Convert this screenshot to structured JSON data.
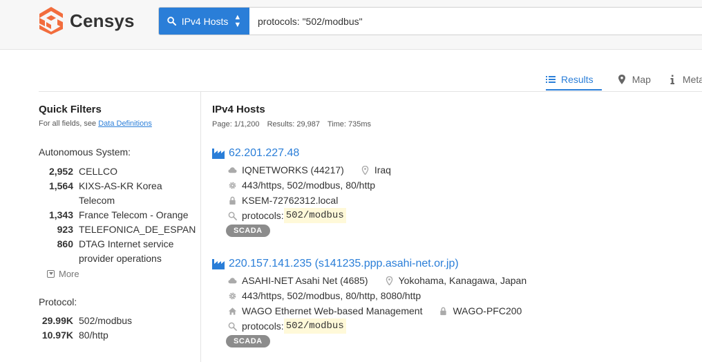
{
  "app": {
    "logo_text": "Censys"
  },
  "search": {
    "type_label": "IPv4 Hosts",
    "query": "protocols: \"502/modbus\""
  },
  "tabs": [
    {
      "label": "Results",
      "icon": "list-icon",
      "active": true
    },
    {
      "label": "Map",
      "icon": "map-marker-icon",
      "active": false
    },
    {
      "label": "Metada",
      "icon": "info-icon",
      "active": false
    }
  ],
  "sidebar": {
    "title": "Quick Filters",
    "subtitle_prefix": "For all fields, see ",
    "subtitle_link": "Data Definitions",
    "facets": [
      {
        "title": "Autonomous System:",
        "items": [
          {
            "count": "2,952",
            "label": "CELLCO"
          },
          {
            "count": "1,564",
            "label": "KIXS-AS-KR Korea Telecom"
          },
          {
            "count": "1,343",
            "label": "France Telecom - Orange"
          },
          {
            "count": "923",
            "label": "TELEFONICA_DE_ESPAN"
          },
          {
            "count": "860",
            "label": "DTAG Internet service provider operations"
          }
        ],
        "more_label": "More"
      },
      {
        "title": "Protocol:",
        "items": [
          {
            "count": "29.99K",
            "label": "502/modbus"
          },
          {
            "count": "10.97K",
            "label": "80/http"
          }
        ]
      }
    ]
  },
  "main": {
    "title": "IPv4 Hosts",
    "page": "Page: 1/1,200",
    "results_count": "Results: 29,987",
    "time": "Time: 735ms",
    "results": [
      {
        "title": "62.201.227.48",
        "network": "IQNETWORKS (44217)",
        "location": "Iraq",
        "services": "443/https, 502/modbus, 80/http",
        "cert": "KSEM-72762312.local",
        "match_prefix": "protocols: ",
        "match_value": "502/modbus",
        "tag": "SCADA"
      },
      {
        "title": "220.157.141.235 (s141235.ppp.asahi-net.or.jp)",
        "network": "ASAHI-NET Asahi Net (4685)",
        "location": "Yokohama, Kanagawa, Japan",
        "services": "443/https, 502/modbus, 80/http, 8080/http",
        "device": "WAGO Ethernet Web-based Management",
        "cert": "WAGO-PFC200",
        "match_prefix": "protocols: ",
        "match_value": "502/modbus",
        "tag": "SCADA"
      }
    ]
  },
  "colors": {
    "accent": "#2a7ed8",
    "logo": "#f26d3d",
    "badge": "#8c8c8c",
    "highlight": "#fff9d9"
  }
}
